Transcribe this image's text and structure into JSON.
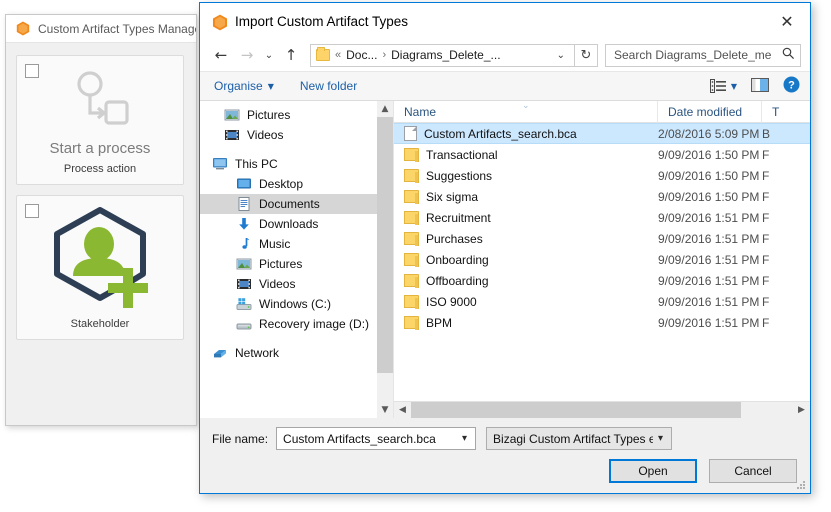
{
  "background_window": {
    "title": "Custom Artifact Types Manage",
    "icon": "bizagi-logo-icon",
    "cards": [
      {
        "title": "Start a process",
        "subtitle": "Process action",
        "icon": "process-action-icon"
      },
      {
        "title": "",
        "subtitle": "Stakeholder",
        "icon": "stakeholder-icon"
      }
    ]
  },
  "dialog": {
    "title": "Import Custom Artifact Types",
    "icon": "bizagi-logo-icon",
    "close_label": "✕",
    "nav": {
      "back": "←",
      "forward": "→",
      "recent": "⌄",
      "up": "↑",
      "breadcrumb": [
        "«",
        "Doc...",
        "›",
        "Diagrams_Delete_..."
      ],
      "dropdown": "⌄",
      "refresh": "↻"
    },
    "search": {
      "placeholder": "Search Diagrams_Delete_me",
      "value": "",
      "icon": "search-icon"
    },
    "toolbar": {
      "organise_label": "Organise",
      "new_folder_label": "New folder",
      "view_icon": "list-view-icon",
      "preview_icon": "preview-pane-icon",
      "help_icon": "help-icon"
    },
    "nav_pane": {
      "items": [
        {
          "label": "Pictures",
          "icon": "pictures-icon",
          "indent": 1,
          "selected": false
        },
        {
          "label": "Videos",
          "icon": "videos-icon",
          "indent": 1,
          "selected": false
        },
        {
          "label": "This PC",
          "icon": "this-pc-icon",
          "indent": 0,
          "selected": false
        },
        {
          "label": "Desktop",
          "icon": "desktop-icon",
          "indent": 1,
          "selected": false
        },
        {
          "label": "Documents",
          "icon": "documents-icon",
          "indent": 1,
          "selected": true
        },
        {
          "label": "Downloads",
          "icon": "downloads-icon",
          "indent": 1,
          "selected": false
        },
        {
          "label": "Music",
          "icon": "music-icon",
          "indent": 1,
          "selected": false
        },
        {
          "label": "Pictures",
          "icon": "pictures-icon",
          "indent": 1,
          "selected": false
        },
        {
          "label": "Videos",
          "icon": "videos-icon",
          "indent": 1,
          "selected": false
        },
        {
          "label": "Windows (C:)",
          "icon": "windows-drive-icon",
          "indent": 1,
          "selected": false
        },
        {
          "label": "Recovery image (D:)",
          "icon": "drive-icon",
          "indent": 1,
          "selected": false
        },
        {
          "label": "Network",
          "icon": "network-icon",
          "indent": 0,
          "selected": false
        }
      ]
    },
    "file_list": {
      "columns": [
        "Name",
        "Date modified",
        "T"
      ],
      "sort_indicator": "⌄",
      "rows": [
        {
          "name": "Custom Artifacts_search.bca",
          "date": "2/08/2016 5:09 PM",
          "type": "B",
          "kind": "file",
          "selected": true
        },
        {
          "name": "Transactional",
          "date": "9/09/2016 1:50 PM",
          "type": "F",
          "kind": "folder",
          "selected": false
        },
        {
          "name": "Suggestions",
          "date": "9/09/2016 1:50 PM",
          "type": "F",
          "kind": "folder",
          "selected": false
        },
        {
          "name": "Six sigma",
          "date": "9/09/2016 1:50 PM",
          "type": "F",
          "kind": "folder",
          "selected": false
        },
        {
          "name": "Recruitment",
          "date": "9/09/2016 1:51 PM",
          "type": "F",
          "kind": "folder",
          "selected": false
        },
        {
          "name": "Purchases",
          "date": "9/09/2016 1:51 PM",
          "type": "F",
          "kind": "folder",
          "selected": false
        },
        {
          "name": "Onboarding",
          "date": "9/09/2016 1:51 PM",
          "type": "F",
          "kind": "folder",
          "selected": false
        },
        {
          "name": "Offboarding",
          "date": "9/09/2016 1:51 PM",
          "type": "F",
          "kind": "folder",
          "selected": false
        },
        {
          "name": "ISO 9000",
          "date": "9/09/2016 1:51 PM",
          "type": "F",
          "kind": "folder",
          "selected": false
        },
        {
          "name": "BPM",
          "date": "9/09/2016 1:51 PM",
          "type": "F",
          "kind": "folder",
          "selected": false
        }
      ]
    },
    "footer": {
      "file_name_label": "File name:",
      "file_name_value": "Custom Artifacts_search.bca",
      "file_type_value": "Bizagi Custom Artifact Types ex",
      "open_label": "Open",
      "cancel_label": "Cancel"
    }
  },
  "colors": {
    "accent": "#0078d7",
    "selection": "#cce8ff",
    "folder": "#fcd568",
    "bizagi_orange": "#f08a1e",
    "green": "#8bb832"
  }
}
